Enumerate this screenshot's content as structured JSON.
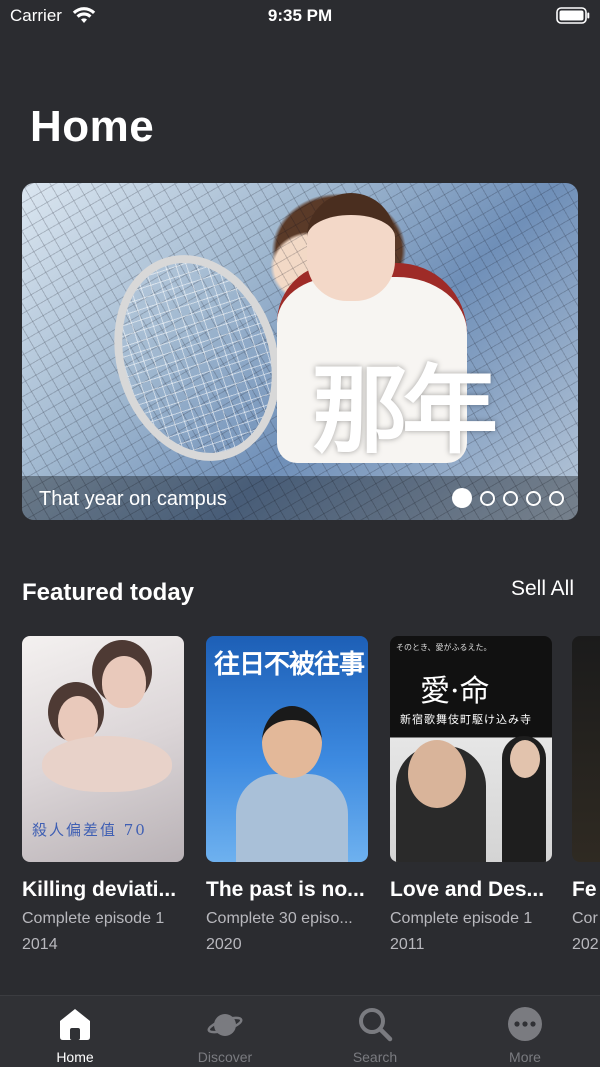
{
  "status_bar": {
    "carrier": "Carrier",
    "time": "9:35 PM"
  },
  "page": {
    "title": "Home"
  },
  "banner": {
    "caption": "That year on campus",
    "calligraphy": "那年",
    "page_count": 5,
    "active_page": 1
  },
  "featured": {
    "title": "Featured today",
    "see_all_label": "Sell All",
    "items": [
      {
        "title": "Killing deviati...",
        "subtitle": "Complete episode 1",
        "year": "2014",
        "poster_text": "殺人偏差值 70"
      },
      {
        "title": "The past is no...",
        "subtitle": "Complete 30 episo...",
        "year": "2020",
        "poster_text": "往日不被往事"
      },
      {
        "title": "Love and Des...",
        "subtitle": "Complete episode 1",
        "year": "2011",
        "poster_text": "愛·命",
        "poster_sub": "新宿歌舞伎町駆け込み寺",
        "poster_top": "そのとき、愛がふるえた。"
      },
      {
        "title": "Fe",
        "subtitle": "Cor",
        "year": "202"
      }
    ]
  },
  "tab_bar": {
    "tabs": [
      {
        "label": "Home",
        "icon": "home-icon",
        "active": true
      },
      {
        "label": "Discover",
        "icon": "planet-icon",
        "active": false
      },
      {
        "label": "Search",
        "icon": "search-icon",
        "active": false
      },
      {
        "label": "More",
        "icon": "more-icon",
        "active": false
      }
    ]
  },
  "colors": {
    "background": "#2b2c30",
    "tab_bar": "#303135",
    "inactive": "#7a7b80",
    "secondary_text": "#b8b8bd"
  }
}
